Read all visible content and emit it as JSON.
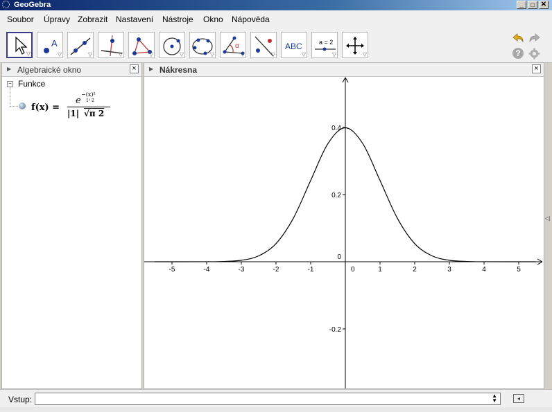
{
  "window": {
    "title": "GeoGebra",
    "minimize_label": "_",
    "maximize_label": "□",
    "close_label": "✕"
  },
  "menu": [
    "Soubor",
    "Úpravy",
    "Zobrazit",
    "Nastavení",
    "Nástroje",
    "Okno",
    "Nápověda"
  ],
  "toolbar": {
    "tools": [
      {
        "name": "move-tool",
        "icon": "pointer-icon",
        "selected": true
      },
      {
        "name": "point-tool",
        "icon": "point-icon",
        "label": "A"
      },
      {
        "name": "line-tool",
        "icon": "line-through-points-icon"
      },
      {
        "name": "perpendicular-tool",
        "icon": "perpendicular-line-icon"
      },
      {
        "name": "polygon-tool",
        "icon": "polygon-icon"
      },
      {
        "name": "circle-tool",
        "icon": "circle-center-point-icon"
      },
      {
        "name": "conic-tool",
        "icon": "conic-five-points-icon"
      },
      {
        "name": "angle-tool",
        "icon": "angle-icon",
        "label": "α"
      },
      {
        "name": "reflect-tool",
        "icon": "reflect-icon"
      },
      {
        "name": "text-tool",
        "icon": "text-icon",
        "label": "ABC"
      },
      {
        "name": "slider-tool",
        "icon": "slider-icon",
        "label": "a = 2"
      },
      {
        "name": "move-view-tool",
        "icon": "move-graphics-view-icon"
      }
    ],
    "undo_icon": "undo-icon",
    "redo_icon": "redo-icon",
    "help_icon": "help-icon",
    "settings_icon": "gear-icon",
    "help_label": "?"
  },
  "algebra": {
    "title": "Algebraické okno",
    "folder": "Funkce",
    "function_label": "f(x) =",
    "numerator": "e",
    "exponent": "−(x)²",
    "exponent_den": "1²·2",
    "denominator_abs": "|1|",
    "denominator_root": "√π 2"
  },
  "graphics": {
    "title": "Nákresna"
  },
  "input": {
    "label": "Vstup:",
    "value": ""
  },
  "chart_data": {
    "type": "line",
    "function": "f(x) = e^(-(x)^2 / (1^2 * 2)) / (|1| * sqrt(pi * 2))",
    "series": [
      {
        "x": [
          -5.5,
          -4,
          -3.5,
          -3,
          -2.5,
          -2,
          -1.5,
          -1,
          -0.5,
          0,
          0.5,
          1,
          1.5,
          2,
          2.5,
          3,
          3.5,
          4,
          5.5
        ],
        "y": [
          0,
          0.0001,
          0.0009,
          0.0044,
          0.0175,
          0.054,
          0.1295,
          0.242,
          0.3521,
          0.3989,
          0.3521,
          0.242,
          0.1295,
          0.054,
          0.0175,
          0.0044,
          0.0009,
          0.0001,
          0
        ]
      }
    ],
    "x_ticks": [
      -5,
      -4,
      -3,
      -2,
      -1,
      0,
      1,
      2,
      3,
      4,
      5
    ],
    "y_ticks": [
      -0.2,
      0,
      0.2,
      0.4
    ],
    "x_tick_labels": [
      "-5",
      "-4",
      "-3",
      "-2",
      "-1",
      "0",
      "1",
      "2",
      "3",
      "4",
      "5"
    ],
    "y_tick_labels": [
      "-0.2",
      "0",
      "0.2",
      "0.4"
    ],
    "xlim": [
      -5.8,
      5.8
    ],
    "ylim": [
      -0.37,
      0.55
    ],
    "grid": false
  }
}
